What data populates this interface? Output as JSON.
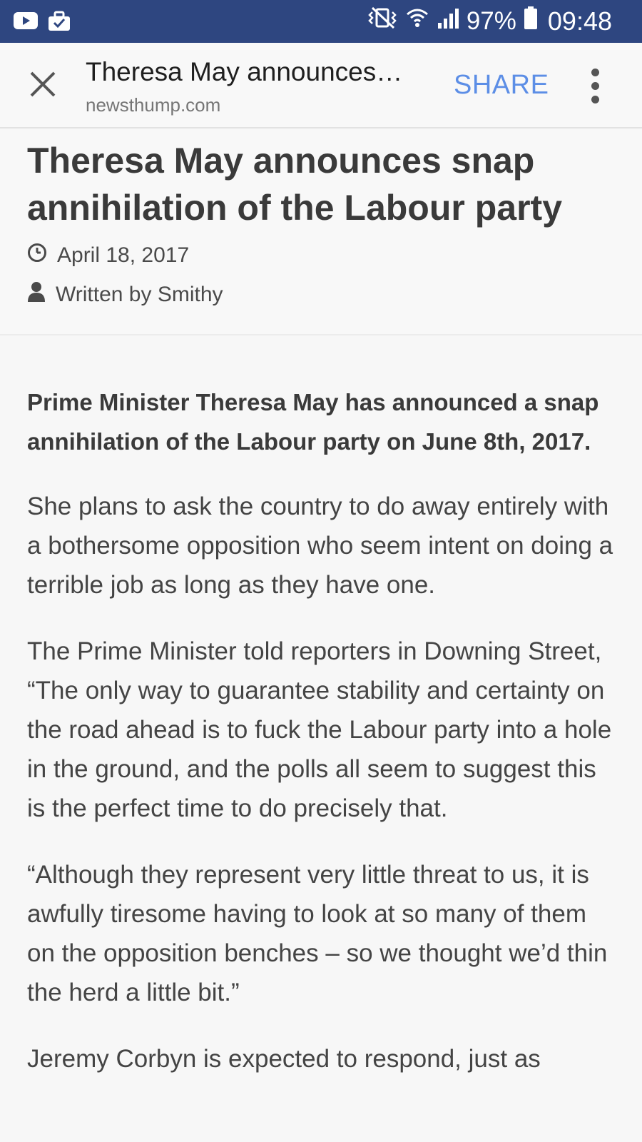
{
  "status_bar": {
    "battery_percent": "97%",
    "time": "09:48",
    "left_icons": [
      "youtube-icon",
      "briefcase-notification-icon"
    ],
    "right_icons": [
      "vibrate-mute-icon",
      "wifi-icon",
      "signal-icon",
      "battery-icon"
    ]
  },
  "toolbar": {
    "title": "Theresa May announces…",
    "domain": "newsthump.com",
    "share_label": "SHARE",
    "share_color": "#5c8ee6"
  },
  "article": {
    "headline": "Theresa May announces snap annihilation of the Labour party",
    "date": "April 18, 2017",
    "author": "Written by Smithy",
    "paragraphs": [
      "Prime Minister Theresa May has announced a snap annihilation of the Labour party on June 8th, 2017.",
      "She plans to ask the country to do away entirely with a bothersome opposition who seem intent on doing a terrible job as long as they have one.",
      "The Prime Minister told reporters in Downing Street, “The only way to guarantee stability and certainty on the road ahead is to fuck the Labour party into a hole in the ground, and the polls all seem to suggest this is the perfect time to do precisely that.",
      "“Although they represent very little threat to us, it is awfully tiresome having to look at so many of them on the opposition benches – so we thought we’d thin the herd a little bit.”",
      "Jeremy Corbyn is expected to respond, just as"
    ]
  },
  "colors": {
    "status_bar_bg": "#2e4680",
    "page_bg": "#f7f7f7",
    "text": "#444444"
  }
}
